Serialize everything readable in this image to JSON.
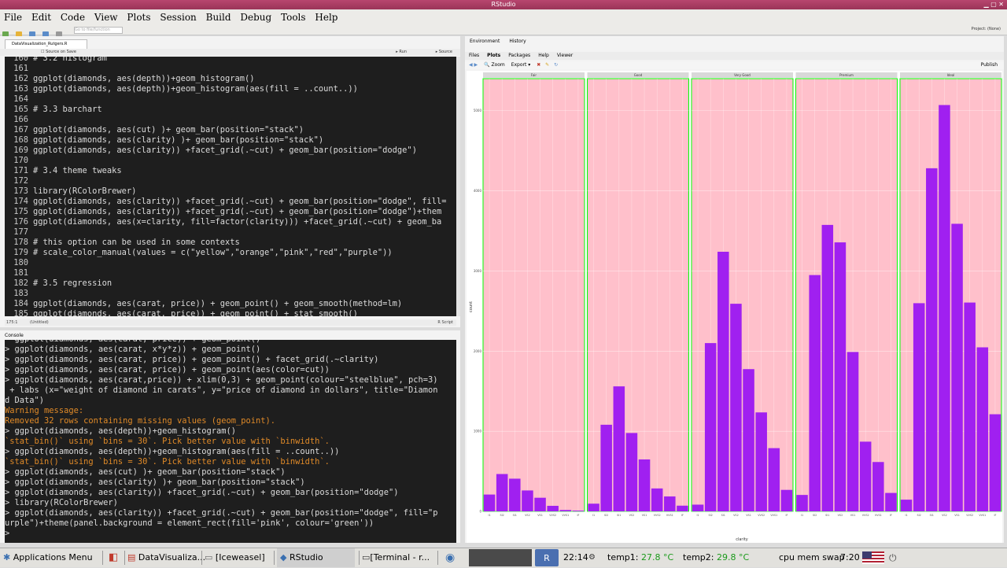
{
  "window": {
    "title": "RStudio"
  },
  "menu": [
    "File",
    "Edit",
    "Code",
    "View",
    "Plots",
    "Session",
    "Build",
    "Debug",
    "Tools",
    "Help"
  ],
  "toolbar": {
    "goto_placeholder": "Go to file/function",
    "project": "Project: (None)"
  },
  "editor": {
    "tab_label": "DataVisualization_Rutgers.R",
    "source_on_save": "Source on Save",
    "run_label": "Run",
    "source_label": "Source",
    "status_pos": "175:1",
    "status_scope": "(Untitled)",
    "status_type": "R Script",
    "lines": [
      {
        "n": "160",
        "t": "# 3.2 histogram"
      },
      {
        "n": "161",
        "t": ""
      },
      {
        "n": "162",
        "t": "ggplot(diamonds, aes(depth))+geom_histogram()"
      },
      {
        "n": "163",
        "t": "ggplot(diamonds, aes(depth))+geom_histogram(aes(fill = ..count..))"
      },
      {
        "n": "164",
        "t": ""
      },
      {
        "n": "165",
        "t": "# 3.3 barchart"
      },
      {
        "n": "166",
        "t": ""
      },
      {
        "n": "167",
        "t": "ggplot(diamonds, aes(cut) )+ geom_bar(position=\"stack\")"
      },
      {
        "n": "168",
        "t": "ggplot(diamonds, aes(clarity) )+ geom_bar(position=\"stack\")"
      },
      {
        "n": "169",
        "t": "ggplot(diamonds, aes(clarity)) +facet_grid(.~cut) + geom_bar(position=\"dodge\")"
      },
      {
        "n": "170",
        "t": ""
      },
      {
        "n": "171",
        "t": "# 3.4 theme tweaks"
      },
      {
        "n": "172",
        "t": ""
      },
      {
        "n": "173",
        "t": "library(RColorBrewer)"
      },
      {
        "n": "174",
        "t": "ggplot(diamonds, aes(clarity)) +facet_grid(.~cut) + geom_bar(position=\"dodge\", fill="
      },
      {
        "n": "175",
        "t": "ggplot(diamonds, aes(clarity)) +facet_grid(.~cut) + geom_bar(position=\"dodge\")+them"
      },
      {
        "n": "176",
        "t": "ggplot(diamonds, aes(x=clarity, fill=factor(clarity))) +facet_grid(.~cut) + geom_ba"
      },
      {
        "n": "177",
        "t": ""
      },
      {
        "n": "178",
        "t": "# this option can be used in some contexts"
      },
      {
        "n": "179",
        "t": "# scale_color_manual(values = c(\"yellow\",\"orange\",\"pink\",\"red\",\"purple\"))"
      },
      {
        "n": "180",
        "t": ""
      },
      {
        "n": "181",
        "t": ""
      },
      {
        "n": "182",
        "t": "# 3.5 regression"
      },
      {
        "n": "183",
        "t": ""
      },
      {
        "n": "184",
        "t": "ggplot(diamonds, aes(carat, price)) + geom_point() + geom_smooth(method=lm)"
      },
      {
        "n": "185",
        "t": "ggplot(diamonds, aes(carat, price)) + geom_point() + stat_smooth()"
      }
    ]
  },
  "console": {
    "title": "Console",
    "lines": [
      {
        "k": "cmd",
        "t": "  ggplot(diamonds, aes(carat, price)) + geom_point()"
      },
      {
        "k": "cmd",
        "t": "> ggplot(diamonds, aes(carat, x*y*z)) + geom_point()"
      },
      {
        "k": "cmd",
        "t": "> ggplot(diamonds, aes(carat, price)) + geom_point() + facet_grid(.~clarity)"
      },
      {
        "k": "cmd",
        "t": "> ggplot(diamonds, aes(carat, price)) + geom_point(aes(color=cut))"
      },
      {
        "k": "cmd",
        "t": "> ggplot(diamonds, aes(carat,price)) + xlim(0,3) + geom_point(colour=\"steelblue\", pch=3)"
      },
      {
        "k": "cmd",
        "t": " + labs (x=\"weight of diamond in carats\", y=\"price of diamond in dollars\", title=\"Diamon"
      },
      {
        "k": "cmd",
        "t": "d Data\")"
      },
      {
        "k": "warn",
        "t": "Warning message:"
      },
      {
        "k": "warn",
        "t": "Removed 32 rows containing missing values (geom_point)."
      },
      {
        "k": "cmd",
        "t": "> ggplot(diamonds, aes(depth))+geom_histogram()"
      },
      {
        "k": "warn",
        "t": "`stat_bin()` using `bins = 30`. Pick better value with `binwidth`."
      },
      {
        "k": "cmd",
        "t": "> ggplot(diamonds, aes(depth))+geom_histogram(aes(fill = ..count..))"
      },
      {
        "k": "warn",
        "t": "`stat_bin()` using `bins = 30`. Pick better value with `binwidth`."
      },
      {
        "k": "cmd",
        "t": "> ggplot(diamonds, aes(cut) )+ geom_bar(position=\"stack\")"
      },
      {
        "k": "cmd",
        "t": "> ggplot(diamonds, aes(clarity) )+ geom_bar(position=\"stack\")"
      },
      {
        "k": "cmd",
        "t": "> ggplot(diamonds, aes(clarity)) +facet_grid(.~cut) + geom_bar(position=\"dodge\")"
      },
      {
        "k": "cmd",
        "t": "> library(RColorBrewer)"
      },
      {
        "k": "cmd",
        "t": "> ggplot(diamonds, aes(clarity)) +facet_grid(.~cut) + geom_bar(position=\"dodge\", fill=\"p"
      },
      {
        "k": "cmd",
        "t": "urple\")+theme(panel.background = element_rect(fill='pink', colour='green'))"
      },
      {
        "k": "cmd",
        "t": ">"
      }
    ]
  },
  "right_pane": {
    "top_tabs": [
      "Environment",
      "History"
    ],
    "tabs": [
      "Files",
      "Plots",
      "Packages",
      "Help",
      "Viewer"
    ],
    "zoom_label": "Zoom",
    "export_label": "Export",
    "publish_label": "Publish"
  },
  "chart_data": {
    "type": "bar",
    "facets": [
      "Fair",
      "Good",
      "Very Good",
      "Premium",
      "Ideal"
    ],
    "categories": [
      "I1",
      "SI2",
      "SI1",
      "VS2",
      "VS1",
      "VVS2",
      "VVS1",
      "IF"
    ],
    "xlabel": "clarity",
    "ylabel": "count",
    "ylim": [
      0,
      5400
    ],
    "yticks": [
      0,
      1000,
      2000,
      3000,
      4000,
      5000
    ],
    "bar_color": "#a020f0",
    "panel_fill": "#ffc0cb",
    "panel_border": "#00ff00",
    "series": [
      {
        "facet": "Fair",
        "values": [
          210,
          466,
          408,
          261,
          170,
          69,
          17,
          9
        ]
      },
      {
        "facet": "Good",
        "values": [
          96,
          1081,
          1560,
          978,
          648,
          286,
          186,
          71
        ]
      },
      {
        "facet": "Very Good",
        "values": [
          84,
          2100,
          3240,
          2591,
          1775,
          1235,
          789,
          268
        ]
      },
      {
        "facet": "Premium",
        "values": [
          205,
          2949,
          3575,
          3357,
          1989,
          870,
          616,
          230
        ]
      },
      {
        "facet": "Ideal",
        "values": [
          146,
          2598,
          4282,
          5071,
          3589,
          2606,
          2047,
          1212
        ]
      }
    ]
  },
  "taskbar": {
    "apps_menu": "Applications Menu",
    "items": [
      "DataVisualiza...",
      "[Iceweasel]",
      "RStudio",
      "[Terminal - r..."
    ],
    "time1": "22:14",
    "temp1_label": "temp1:",
    "temp1_val": "27.8 °C",
    "temp2_label": "temp2:",
    "temp2_val": "29.8 °C",
    "cpu_label": "cpu mem swap",
    "time2": "7:20"
  }
}
